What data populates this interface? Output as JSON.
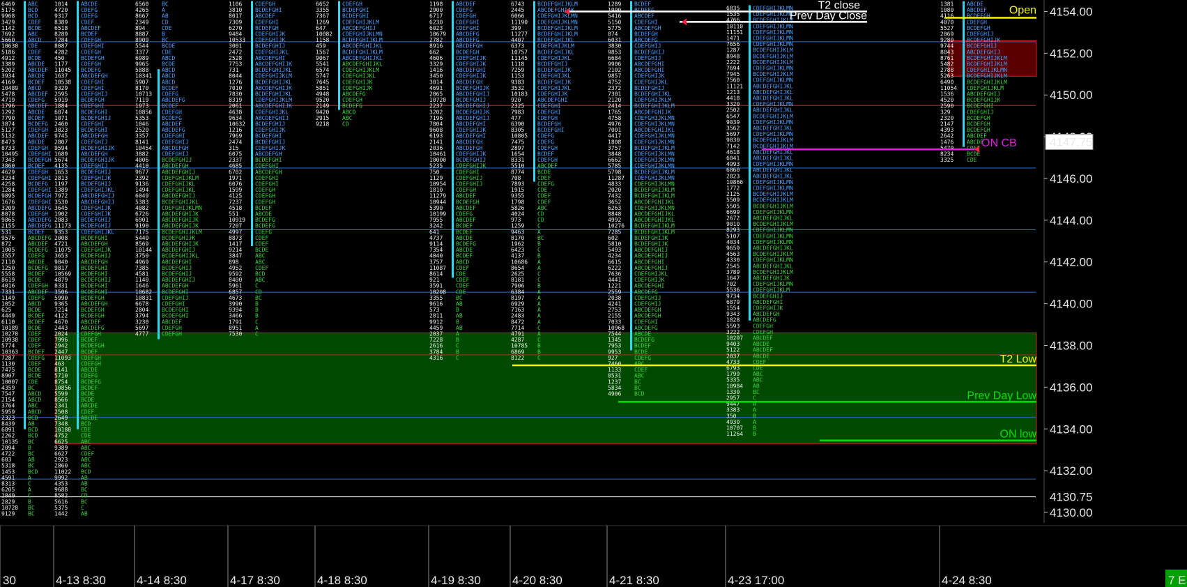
{
  "chart_data": {
    "type": "market-profile",
    "price_axis": {
      "ticks": [
        4130.0,
        4132.0,
        4134.0,
        4136.0,
        4138.0,
        4140.0,
        4142.0,
        4144.0,
        4146.0,
        4148.0,
        4150.0,
        4152.0,
        4154.0
      ],
      "tick_labels": [
        "4130.00",
        "4132.00",
        "4134.00",
        "4136.00",
        "4138.00",
        "4140.00",
        "4142.00",
        "4144.00",
        "4146.00",
        "4148.00",
        "4150.00",
        "4152.00",
        "4154.00"
      ],
      "ylim": [
        4129.5,
        4154.55
      ],
      "position": "right",
      "highlight_last": {
        "value": 4147.75,
        "label": "4147.75"
      },
      "highlight_low": {
        "value": 4130.75,
        "label": "4130.75"
      }
    },
    "sessions": [
      {
        "label": "30",
        "open": 4149.5,
        "high": 4154.5,
        "low": 4129.6,
        "poc": 4145.1
      },
      {
        "label": "4-13  8:30",
        "open": 4146.5,
        "high": 4154.5,
        "low": 4129.6,
        "poc": 4145.1
      },
      {
        "label": "4-14  8:30",
        "open": 4150.5,
        "high": 4154.5,
        "low": 4138.3,
        "poc": 4144.0
      },
      {
        "label": "4-17  8:30",
        "open": 4153.0,
        "high": 4154.5,
        "low": 4138.3,
        "poc": 4150.0
      },
      {
        "label": "4-18  8:30",
        "open": 4153.5,
        "high": 4154.5,
        "low": 4148.2,
        "poc": 4152.0
      },
      {
        "label": "4-19  8:30",
        "open": 4154.0,
        "high": 4154.5,
        "low": 4137.2,
        "poc": 4149.0
      },
      {
        "label": "4-20  8:30",
        "open": 4153.0,
        "high": 4154.5,
        "low": 4137.2,
        "poc": 4153.6
      },
      {
        "label": "4-21  8:30",
        "open": 4151.5,
        "high": 4154.5,
        "low": 4135.3,
        "poc": 4146.3
      },
      {
        "label": "4-23  17:00",
        "open": 4148.0,
        "high": 4154.3,
        "low": 4133.5,
        "poc": 4148.5
      },
      {
        "label": "4-24  8:30",
        "open": 4153.8,
        "high": 4154.5,
        "low": 4146.5,
        "poc": 4151.0
      }
    ],
    "levels": [
      {
        "name": "T2 close",
        "price": 4154.0,
        "color": "#ffffff"
      },
      {
        "name": "Prev Day Close",
        "price": 4153.5,
        "color": "#ffffff"
      },
      {
        "name": "Open",
        "price": 4153.7,
        "color": "#f5f500"
      },
      {
        "name": "ON CB",
        "price": 4147.4,
        "color": "#e020e0"
      },
      {
        "name": "T2 Low",
        "price": 4137.05,
        "color": "#f5f500"
      },
      {
        "name": "Prev Day Low",
        "price": 4135.3,
        "color": "#00e000"
      },
      {
        "name": "ON low",
        "price": 4133.45,
        "color": "#00e000"
      }
    ],
    "zones": [
      {
        "name": "green-zone",
        "from": 4133.3,
        "to": 4138.6,
        "fill": "#004a00",
        "border": "#d02020"
      },
      {
        "name": "red-zone",
        "from": 4150.9,
        "to": 4152.6,
        "fill": "#5a0000",
        "border": "#d02020"
      }
    ],
    "reference_lines": [
      {
        "price": 4152.55,
        "color": "#2a6fd6"
      },
      {
        "price": 4149.5,
        "color": "#d02020"
      },
      {
        "price": 4146.5,
        "color": "#2a6fd6"
      },
      {
        "price": 4143.55,
        "color": "#2a6fd6"
      },
      {
        "price": 4140.55,
        "color": "#2a6fd6"
      },
      {
        "price": 4137.55,
        "color": "#d02020"
      },
      {
        "price": 4134.55,
        "color": "#2a6fd6"
      },
      {
        "price": 4131.6,
        "color": "#2a6fd6"
      },
      {
        "price": 4130.75,
        "color": "#ffffff"
      }
    ],
    "badge": {
      "text": "7 E",
      "color": "#00a000"
    }
  },
  "colors": {
    "background": "#000000",
    "tpo_blue": "#4aa0ff",
    "tpo_green": "#3ed23e",
    "tpo_yellow": "#f5f500",
    "tpo_magenta": "#ff40ff",
    "poc_cyan": "#30d8f0",
    "axis_text": "#e8e8e8"
  }
}
